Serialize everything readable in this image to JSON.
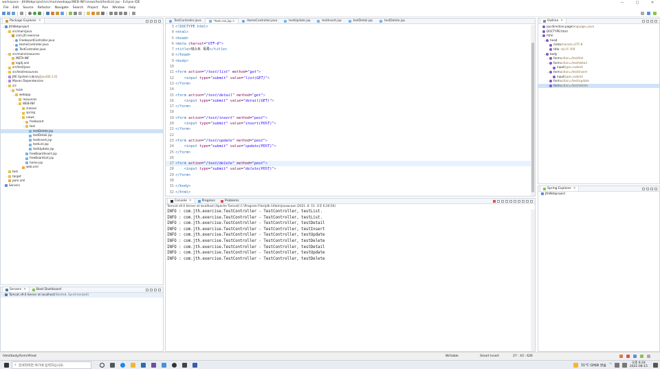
{
  "window": {
    "title": "workspace - JthWebproject/src/main/webapp/WEB-INF/views/test/testList.jsp - Eclipse IDE",
    "controls": [
      "—",
      "□",
      "✕"
    ]
  },
  "menu": [
    "File",
    "Edit",
    "Source",
    "Refactor",
    "Navigate",
    "Search",
    "Project",
    "Run",
    "Window",
    "Help"
  ],
  "package_explorer": {
    "title": "Package Explorer",
    "tree": [
      {
        "label": "JthWebproject",
        "depth": 0,
        "icon": "project-icon",
        "open": "v"
      },
      {
        "label": "src/main/java",
        "depth": 1,
        "icon": "folder-icon",
        "open": "v"
      },
      {
        "label": "com.jth.exercise",
        "depth": 2,
        "icon": "package-icon",
        "open": "v"
      },
      {
        "label": "FreeboardController.java",
        "depth": 3,
        "icon": "java-file-icon",
        "open": ">"
      },
      {
        "label": "HomeController.java",
        "depth": 3,
        "icon": "java-file-icon",
        "open": ">"
      },
      {
        "label": "TestController.java",
        "depth": 3,
        "icon": "java-file-icon",
        "open": ">"
      },
      {
        "label": "src/main/resources",
        "depth": 1,
        "icon": "folder-icon",
        "open": "v"
      },
      {
        "label": "META-INF",
        "depth": 2,
        "icon": "folder-icon",
        "open": ""
      },
      {
        "label": "log4j.xml",
        "depth": 2,
        "icon": "xml-file-icon",
        "open": ""
      },
      {
        "label": "src/test/java",
        "depth": 1,
        "icon": "folder-icon",
        "open": ">"
      },
      {
        "label": "src/test/resources",
        "depth": 1,
        "icon": "folder-icon",
        "open": ">"
      },
      {
        "label": "JRE System Library",
        "depth": 1,
        "icon": "library-icon",
        "open": ">",
        "suffix": " [JavaSE-1.6]"
      },
      {
        "label": "Maven Dependencies",
        "depth": 1,
        "icon": "library-icon",
        "open": ">"
      },
      {
        "label": "src",
        "depth": 1,
        "icon": "folder-icon",
        "open": "v"
      },
      {
        "label": "main",
        "depth": 2,
        "icon": "folder-icon",
        "open": "v"
      },
      {
        "label": "webapp",
        "depth": 3,
        "icon": "folder-icon",
        "open": "v"
      },
      {
        "label": "resources",
        "depth": 4,
        "icon": "folder-icon",
        "open": ""
      },
      {
        "label": "WEB-INF",
        "depth": 4,
        "icon": "folder-icon",
        "open": "v"
      },
      {
        "label": "classes",
        "depth": 5,
        "icon": "folder-icon",
        "open": ""
      },
      {
        "label": "spring",
        "depth": 5,
        "icon": "folder-icon",
        "open": ">"
      },
      {
        "label": "views",
        "depth": 5,
        "icon": "folder-icon",
        "open": "v"
      },
      {
        "label": "freeboard",
        "depth": 6,
        "icon": "folder-icon",
        "open": ">"
      },
      {
        "label": "test",
        "depth": 6,
        "icon": "folder-icon",
        "open": "v"
      },
      {
        "label": "testDelete.jsp",
        "depth": 7,
        "icon": "jsp-file-icon",
        "open": "",
        "selected": true
      },
      {
        "label": "testDetail.jsp",
        "depth": 7,
        "icon": "jsp-file-icon",
        "open": ""
      },
      {
        "label": "testInsert.jsp",
        "depth": 7,
        "icon": "jsp-file-icon",
        "open": ""
      },
      {
        "label": "testList.jsp",
        "depth": 7,
        "icon": "jsp-file-icon",
        "open": ""
      },
      {
        "label": "testUpdate.jsp",
        "depth": 7,
        "icon": "jsp-file-icon",
        "open": ""
      },
      {
        "label": "freeBoardInsert.jsp",
        "depth": 6,
        "icon": "jsp-file-icon",
        "open": ""
      },
      {
        "label": "freeBoardList.jsp",
        "depth": 6,
        "icon": "jsp-file-icon",
        "open": ""
      },
      {
        "label": "home.jsp",
        "depth": 6,
        "icon": "jsp-file-icon",
        "open": ""
      },
      {
        "label": "web.xml",
        "depth": 5,
        "icon": "xml-file-icon",
        "open": ""
      },
      {
        "label": "test",
        "depth": 1,
        "icon": "folder-icon",
        "open": ""
      },
      {
        "label": "target",
        "depth": 1,
        "icon": "folder-icon",
        "open": ">"
      },
      {
        "label": "pom.xml",
        "depth": 1,
        "icon": "xml-file-icon",
        "open": ""
      },
      {
        "label": "Servers",
        "depth": 0,
        "icon": "project-icon",
        "open": ">"
      }
    ]
  },
  "servers": {
    "tabs": [
      "Servers",
      "Boot Dashboard"
    ],
    "item": "Tomcat v9.0 Server at localhost",
    "item_status": " [Started, Synchronized]"
  },
  "editor": {
    "tabs": [
      {
        "label": "TestController.java",
        "active": false
      },
      {
        "label": "*test.css.jsp",
        "active": true
      },
      {
        "label": "HomeController.java",
        "active": false
      },
      {
        "label": "testUpdate.jsp",
        "active": false
      },
      {
        "label": "testInsert.jsp",
        "active": false
      },
      {
        "label": "testDetail.jsp",
        "active": false
      },
      {
        "label": "testDelete.jsp",
        "active": false
      }
    ],
    "lines": [
      {
        "n": "3",
        "html": "<span class='t-tag'>&lt;!DOCTYPE html&gt;</span>"
      },
      {
        "n": "4",
        "html": "<span class='t-tag'>&lt;html&gt;</span>"
      },
      {
        "n": "5",
        "html": "<span class='t-tag'>&lt;head&gt;</span>"
      },
      {
        "n": "6",
        "html": "<span class='t-tag'>&lt;meta</span> <span class='t-attr'>charset</span>=<span class='t-str'>\"UTF-8\"</span><span class='t-tag'>&gt;</span>"
      },
      {
        "n": "7",
        "html": "<span class='t-tag'>&lt;title&gt;</span>테스트 목록<span class='t-tag'>&lt;/title&gt;</span>"
      },
      {
        "n": "8",
        "html": "<span class='t-tag'>&lt;/head&gt;</span>"
      },
      {
        "n": "9",
        "html": "<span class='t-tag'>&lt;body&gt;</span>"
      },
      {
        "n": "10",
        "html": ""
      },
      {
        "n": "11",
        "html": "<span class='t-tag'>&lt;form</span> <span class='t-attr'>action</span>=<span class='t-str'>\"/test/list\"</span> <span class='t-attr'>method</span>=<span class='t-str'>\"get\"</span><span class='t-tag'>&gt;</span>"
      },
      {
        "n": "12",
        "html": "    <span class='t-tag'>&lt;input</span> <span class='t-attr'>type</span>=<span class='t-str'>\"submit\"</span> <span class='t-attr'>value</span>=<span class='t-str'>\"list(GET)\"</span><span class='t-tag'>&gt;</span>"
      },
      {
        "n": "13",
        "html": "<span class='t-tag'>&lt;/form&gt;</span>"
      },
      {
        "n": "14",
        "html": ""
      },
      {
        "n": "15",
        "html": "<span class='t-tag'>&lt;form</span> <span class='t-attr'>action</span>=<span class='t-str'>\"/test/detail\"</span> <span class='t-attr'>method</span>=<span class='t-str'>\"get\"</span><span class='t-tag'>&gt;</span>"
      },
      {
        "n": "16",
        "html": "    <span class='t-tag'>&lt;input</span> <span class='t-attr'>type</span>=<span class='t-str'>\"submit\"</span> <span class='t-attr'>value</span>=<span class='t-str'>\"detail(GET)\"</span><span class='t-tag'>&gt;</span>"
      },
      {
        "n": "17",
        "html": "<span class='t-tag'>&lt;/form&gt;</span>"
      },
      {
        "n": "18",
        "html": ""
      },
      {
        "n": "19",
        "html": "<span class='t-tag'>&lt;form</span> <span class='t-attr'>action</span>=<span class='t-str'>\"/test/insert\"</span> <span class='t-attr'>method</span>=<span class='t-str'>\"post\"</span><span class='t-tag'>&gt;</span>"
      },
      {
        "n": "20",
        "html": "    <span class='t-tag'>&lt;input</span> <span class='t-attr'>type</span>=<span class='t-str'>\"submit\"</span> <span class='t-attr'>value</span>=<span class='t-str'>\"insert(POST)\"</span><span class='t-tag'>&gt;</span>"
      },
      {
        "n": "21",
        "html": "<span class='t-tag'>&lt;/form&gt;</span>"
      },
      {
        "n": "22",
        "html": ""
      },
      {
        "n": "23",
        "html": "<span class='t-tag'>&lt;form</span> <span class='t-attr'>action</span>=<span class='t-str'>\"/test/update\"</span> <span class='t-attr'>method</span>=<span class='t-str'>\"post\"</span><span class='t-tag'>&gt;</span>"
      },
      {
        "n": "24",
        "html": "    <span class='t-tag'>&lt;input</span> <span class='t-attr'>type</span>=<span class='t-str'>\"submit\"</span> <span class='t-attr'>value</span>=<span class='t-str'>\"update(POST)\"</span><span class='t-tag'>&gt;</span>"
      },
      {
        "n": "25",
        "html": "<span class='t-tag'>&lt;/form&gt;</span>"
      },
      {
        "n": "26",
        "html": ""
      },
      {
        "n": "27",
        "html": "<span class='t-tag'>&lt;form</span> <span class='t-attr'>action</span>=<span class='t-str'>\"/test/delete\"</span> <span class='t-attr'>method</span>=<span class='t-str'>\"post\"</span><span class='t-tag'>&gt;</span>",
        "current": true
      },
      {
        "n": "28",
        "html": "    <span class='t-tag'>&lt;input</span> <span class='t-attr'>type</span>=<span class='t-str'>\"submit\"</span> <span class='t-attr'>value</span>=<span class='t-str'>\"delete(POST)\"</span><span class='t-tag'>&gt;</span>"
      },
      {
        "n": "29",
        "html": "<span class='t-tag'>&lt;/form&gt;</span>"
      },
      {
        "n": "30",
        "html": ""
      },
      {
        "n": "31",
        "html": "<span class='t-tag'>&lt;/body&gt;</span>"
      },
      {
        "n": "32",
        "html": "<span class='t-tag'>&lt;/html&gt;</span>"
      }
    ]
  },
  "outline": {
    "title": "Outline",
    "tree": [
      {
        "label": "jsp:directive.page",
        "suffix": " language=java",
        "depth": 0,
        "open": ""
      },
      {
        "label": "DOCTYPE:html",
        "depth": 0,
        "open": ""
      },
      {
        "label": "html",
        "depth": 0,
        "open": "v"
      },
      {
        "label": "head",
        "depth": 1,
        "open": "v"
      },
      {
        "label": "meta",
        "suffix": " charset=UTF-8",
        "depth": 2,
        "open": ""
      },
      {
        "label": "title",
        "suffix": " - 테스트 목록",
        "depth": 2,
        "open": ""
      },
      {
        "label": "body",
        "depth": 1,
        "open": "v"
      },
      {
        "label": "form",
        "suffix": " action=/test/list",
        "depth": 2,
        "open": ">"
      },
      {
        "label": "form",
        "suffix": " action=/test/detail",
        "depth": 2,
        "open": "v"
      },
      {
        "label": "input",
        "suffix": " type=submit",
        "depth": 3,
        "open": ""
      },
      {
        "label": "form",
        "suffix": " action=/test/insert",
        "depth": 2,
        "open": "v"
      },
      {
        "label": "input",
        "suffix": " type=submit",
        "depth": 3,
        "open": ""
      },
      {
        "label": "form",
        "suffix": " action=/test/update",
        "depth": 2,
        "open": ">"
      },
      {
        "label": "form",
        "suffix": " action=/test/delete",
        "depth": 2,
        "open": ">",
        "selected": true
      }
    ]
  },
  "spring_explorer": {
    "title": "Spring Explorer",
    "item": "JthWebproject"
  },
  "console": {
    "tabs": [
      "Console",
      "Progress",
      "Problems"
    ],
    "header": "Tomcat v9.0 Server at localhost [Apache Tomcat] C:\\Program Files\\jdk-14\\bin\\javaw.exe (2021. 8. 15. 오후 6:20:50)",
    "lines": [
      "INFO : com.jth.exercise.TestController - TestController, testList.",
      "INFO : com.jth.exercise.TestController - TestController, testList.",
      "INFO : com.jth.exercise.TestController - TestController, testDetail",
      "INFO : com.jth.exercise.TestController - TestController, testInsert",
      "INFO : com.jth.exercise.TestController - TestController, testUpdate",
      "INFO : com.jth.exercise.TestController - TestController, testDelete",
      "INFO : com.jth.exercise.TestController - TestController, testDetail",
      "INFO : com.jth.exercise.TestController - TestController, testUpdate",
      "INFO : com.jth.exercise.TestController - TestController, testDelete"
    ]
  },
  "statusbar": {
    "path": "html/body/form/#text",
    "writable": "Writable",
    "insert_mode": "Smart Insert",
    "position": "27 : 43 : 626"
  },
  "taskbar": {
    "search_placeholder": "검색하려면 여기에 입력하십시오.",
    "weather": "31°C 대체로 맑음",
    "time": "오후 6:24",
    "date": "2021-08-15"
  },
  "colors": {
    "accent": "#2f6fb8",
    "selection": "#cfe3f7",
    "panel_border": "#cfd6de"
  }
}
